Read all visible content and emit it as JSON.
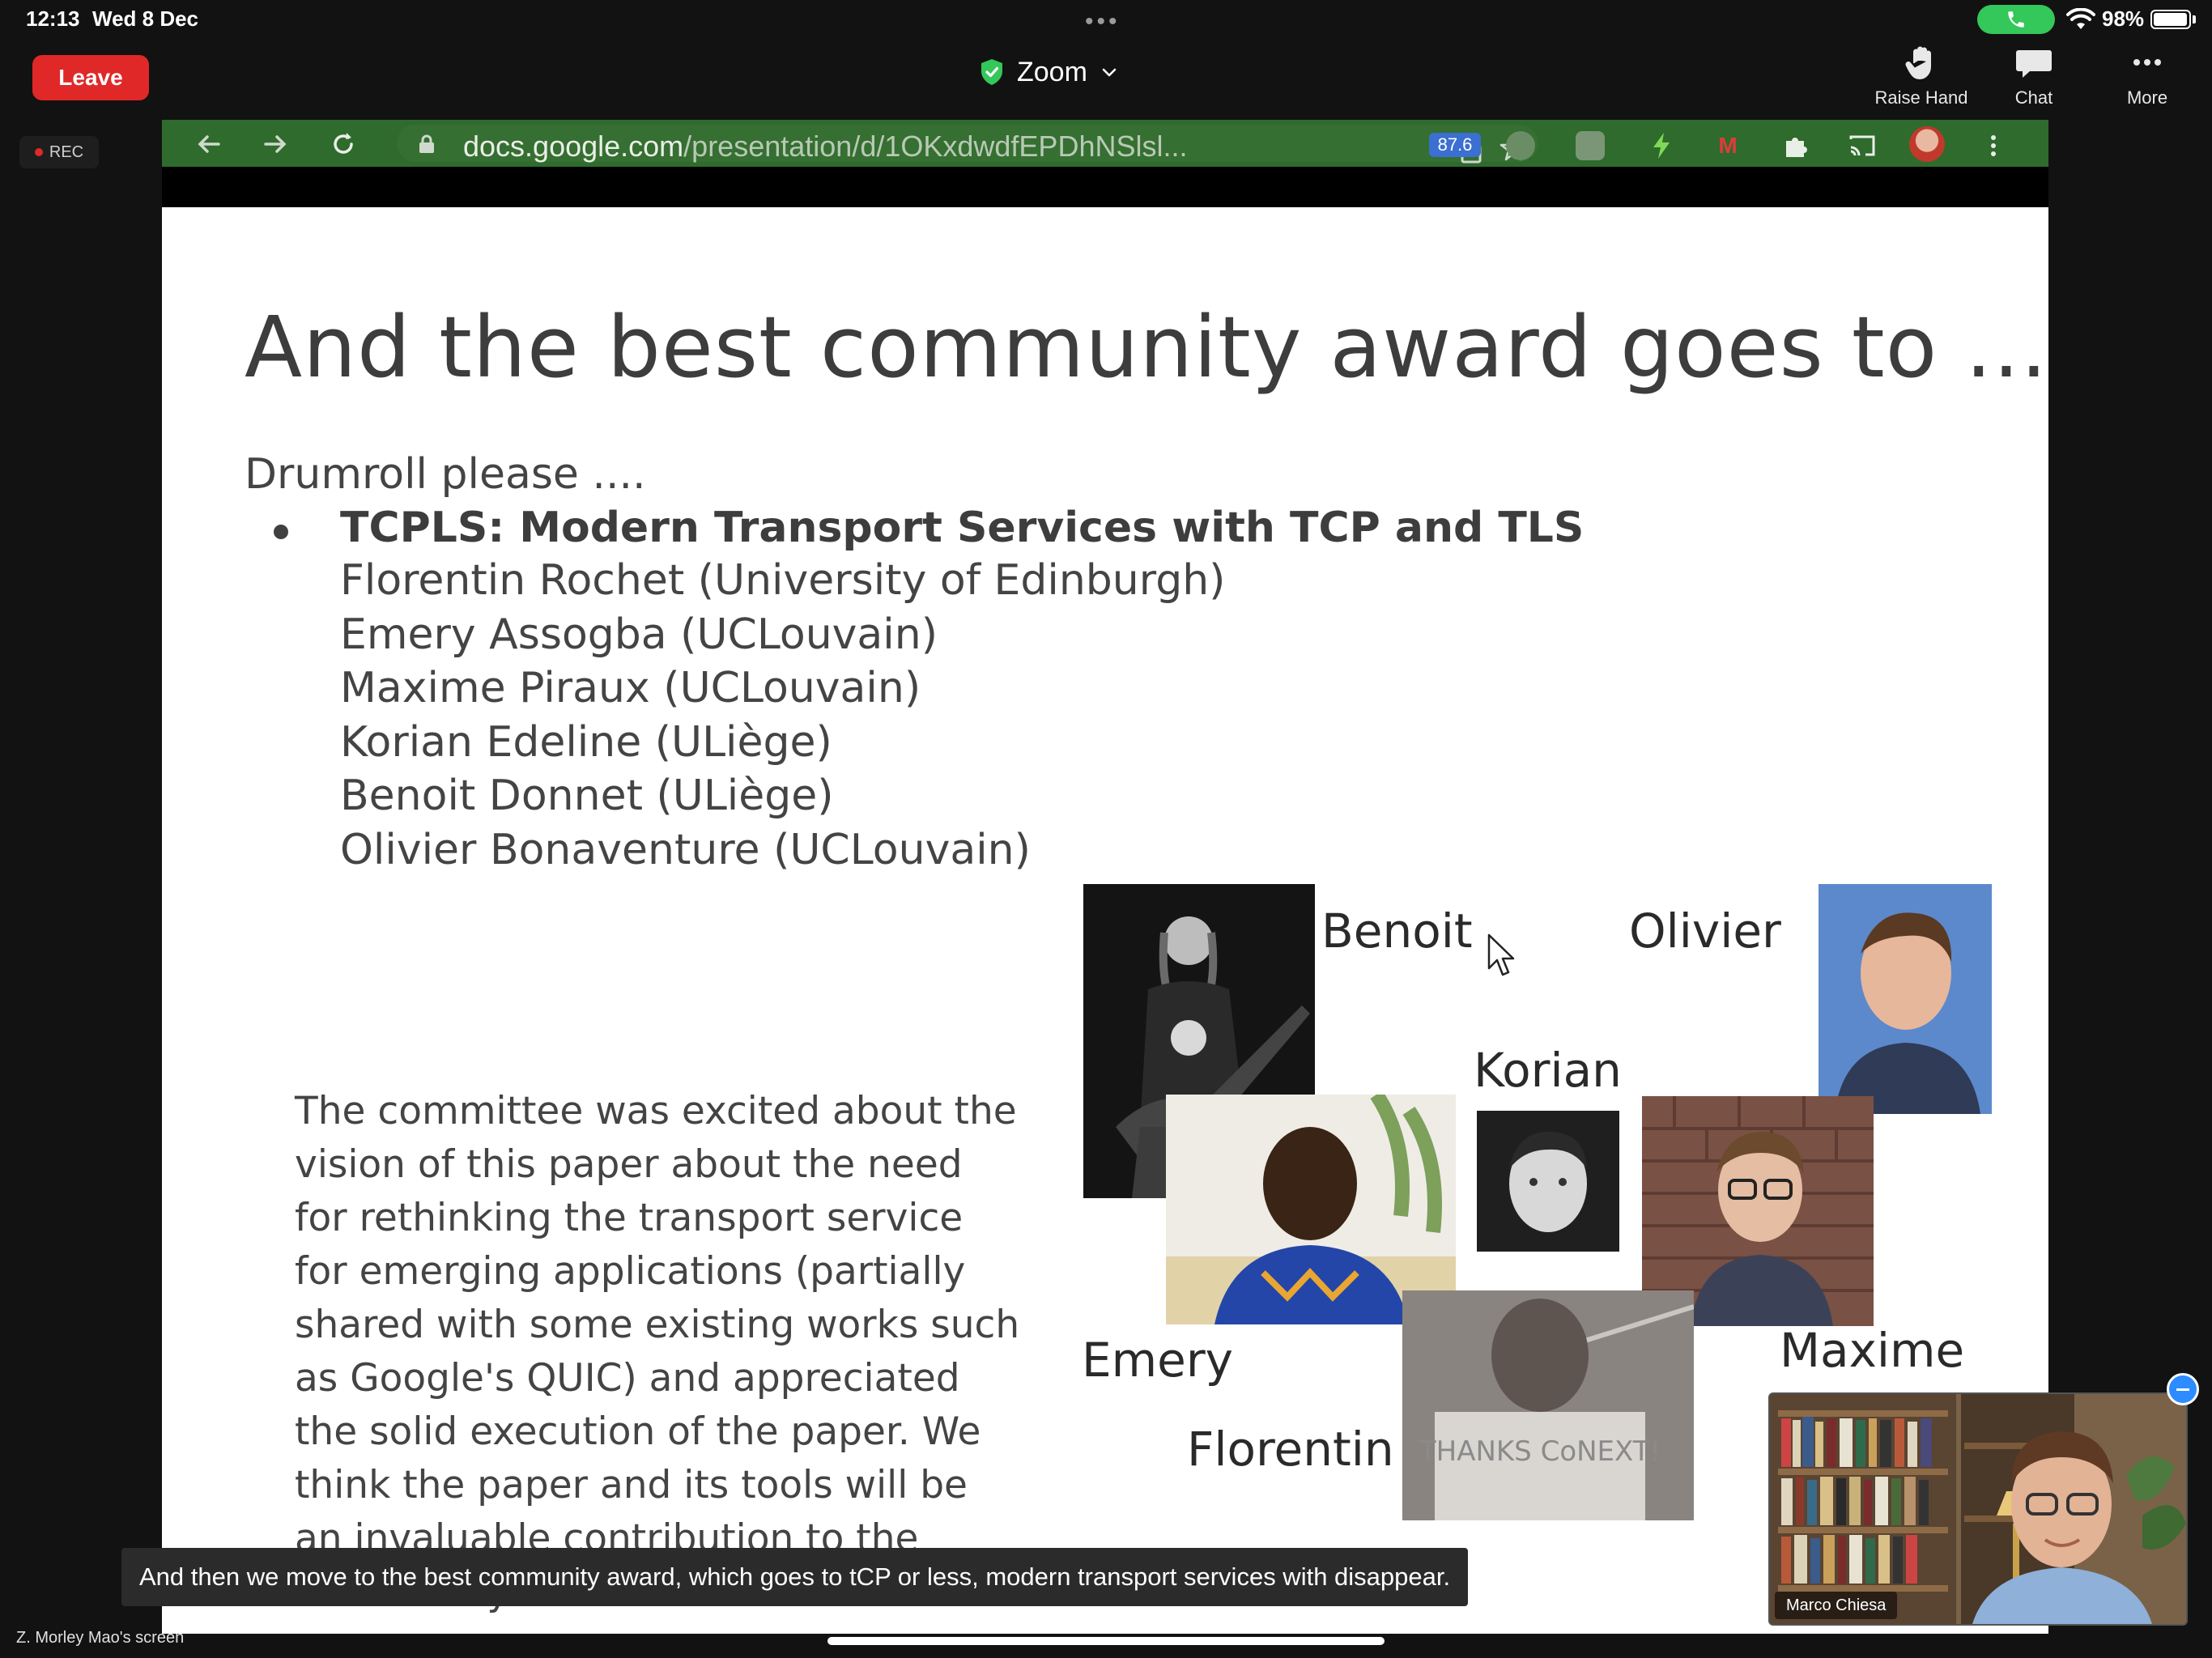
{
  "status_bar": {
    "time": "12:13",
    "date": "Wed 8 Dec",
    "battery": "98%",
    "battery_level": 0.98
  },
  "toolbar": {
    "leave_label": "Leave",
    "meeting_title": "Zoom",
    "rec_label": "REC",
    "tools": [
      {
        "label": "Raise Hand",
        "icon": "raise-hand-icon"
      },
      {
        "label": "Chat",
        "icon": "chat-icon"
      },
      {
        "label": "More",
        "icon": "more-icon"
      }
    ]
  },
  "browser": {
    "url_domain": "docs.google.com",
    "url_path": "/presentation/d/1OKxdwdfEPDhNSlsl...",
    "extension_badge": "87.6"
  },
  "slide": {
    "title": "And the best community award goes to ...",
    "subtitle": "Drumroll please ....",
    "paper_title": "TCPLS: Modern Transport Services with TCP and TLS",
    "authors": [
      "Florentin Rochet (University of Edinburgh)",
      "Emery Assogba (UCLouvain)",
      "Maxime Piraux (UCLouvain)",
      "Korian Edeline (ULiège)",
      "Benoit Donnet (ULiège)",
      "Olivier Bonaventure (UCLouvain)"
    ],
    "committee_lines": [
      "The committee was excited about the",
      "vision of this paper about the need",
      "for rethinking the transport service",
      "for emerging applications (partially",
      "shared with some existing works such",
      "as Google's QUIC) and appreciated",
      "the solid execution of the paper. We",
      "think the paper and its tools will be",
      "an invaluable contribution to the",
      "community."
    ],
    "photo_labels": {
      "benoit": "Benoit",
      "olivier": "Olivier",
      "korian": "Korian",
      "emery": "Emery",
      "maxime": "Maxime",
      "florentin": "Florentin"
    },
    "sign_text": "THANKS CoNEXT!"
  },
  "caption": "And then we move to the best community award, which goes to tCP or less, modern transport services with disappear.",
  "self_video": {
    "name": "Marco Chiesa"
  },
  "screen_owner": "Z. Morley Mao's screen",
  "colors": {
    "leave": "#e02828",
    "call": "#34c759",
    "browser_bar": "#2f6b2c",
    "accent": "#2d8cff"
  }
}
